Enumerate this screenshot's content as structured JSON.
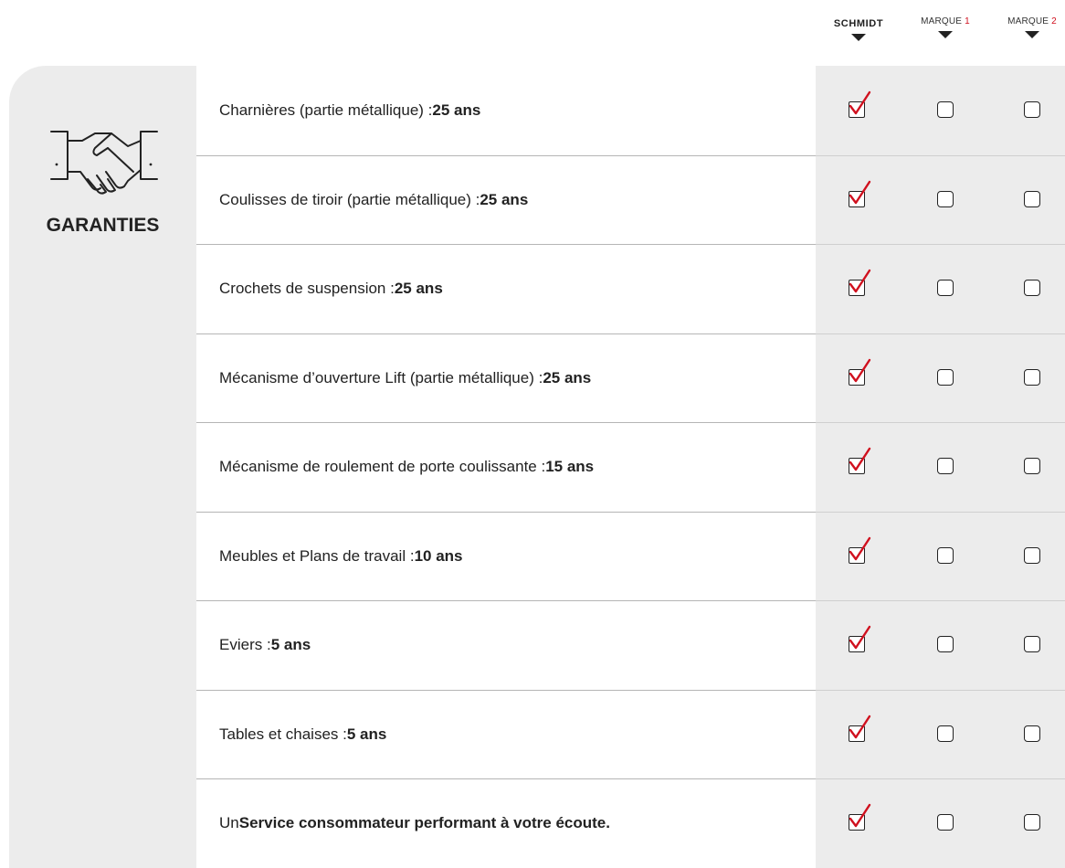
{
  "header": {
    "columns": [
      {
        "label": "SCHMIDT",
        "type": "logo"
      },
      {
        "label": "MARQUE",
        "number": "1",
        "type": "text"
      },
      {
        "label": "MARQUE",
        "number": "2",
        "type": "text"
      }
    ]
  },
  "category": {
    "title": "GARANTIES",
    "icon": "handshake-icon"
  },
  "colors": {
    "accent_red": "#d0101e",
    "panel_gray": "#ececec"
  },
  "rows": [
    {
      "prefix": "Charnières (partie métallique) : ",
      "bold": "25 ans",
      "checks": [
        true,
        false,
        false
      ]
    },
    {
      "prefix": "Coulisses de tiroir (partie métallique) : ",
      "bold": "25 ans",
      "checks": [
        true,
        false,
        false
      ]
    },
    {
      "prefix": "Crochets de suspension : ",
      "bold": "25 ans",
      "checks": [
        true,
        false,
        false
      ]
    },
    {
      "prefix": "Mécanisme d’ouverture Lift (partie métallique) : ",
      "bold": "25 ans",
      "checks": [
        true,
        false,
        false
      ]
    },
    {
      "prefix": "Mécanisme de roulement de porte coulissante : ",
      "bold": "15 ans",
      "checks": [
        true,
        false,
        false
      ]
    },
    {
      "prefix": "Meubles et Plans de travail : ",
      "bold": "10 ans",
      "checks": [
        true,
        false,
        false
      ]
    },
    {
      "prefix": "Eviers : ",
      "bold": "5 ans",
      "checks": [
        true,
        false,
        false
      ]
    },
    {
      "prefix": "Tables et chaises : ",
      "bold": "5 ans",
      "checks": [
        true,
        false,
        false
      ]
    },
    {
      "prefix": "Un ",
      "bold": "Service consommateur performant à votre écoute.",
      "checks": [
        true,
        false,
        false
      ]
    }
  ]
}
